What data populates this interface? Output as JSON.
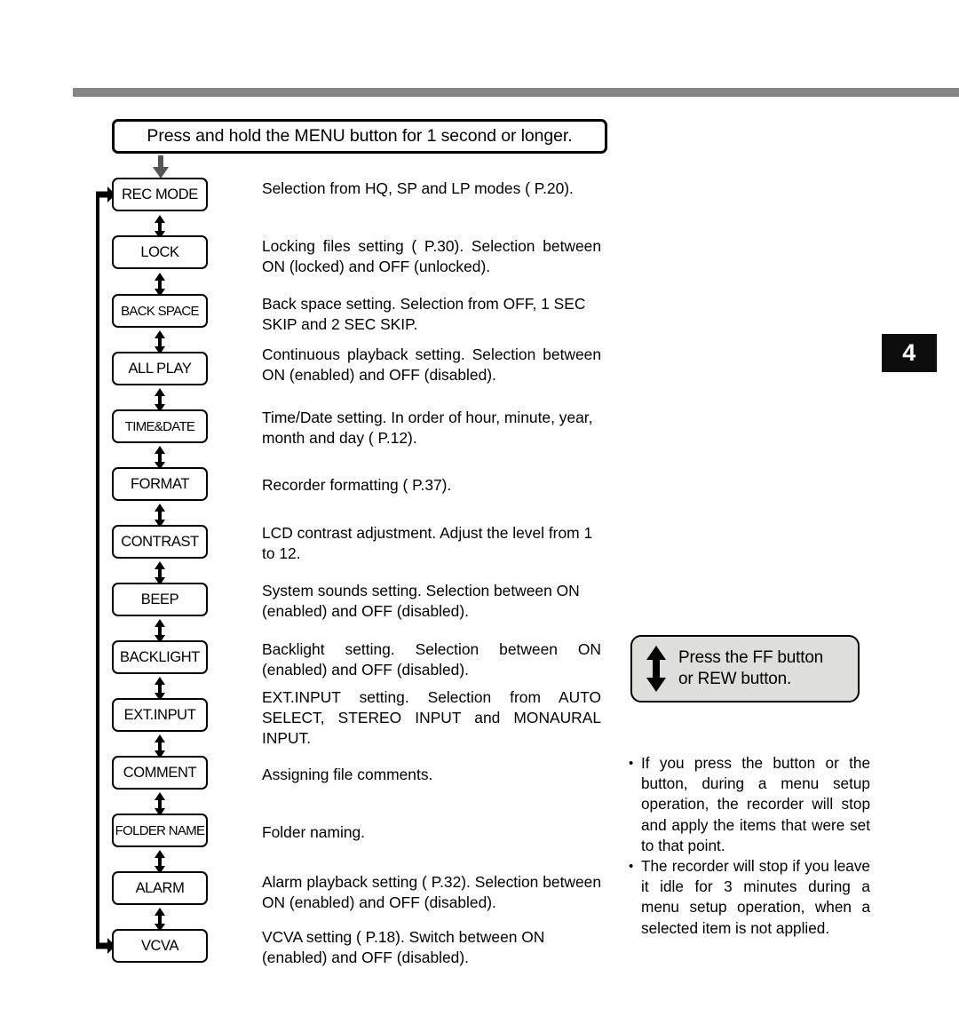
{
  "page": {
    "number": "4"
  },
  "header": {
    "instruction": "Press and hold the MENU  button for 1 second or longer."
  },
  "menu_items": [
    {
      "label": "REC MODE",
      "description": "Selection from  HQ, SP and LP modes (    P.20)."
    },
    {
      "label": "LOCK",
      "description": "Locking files setting (    P.30). Selection between ON (locked) and OFF (unlocked)."
    },
    {
      "label": "BACK SPACE",
      "description": "Back space setting. Selection from OFF, 1 SEC SKIP and 2 SEC SKIP."
    },
    {
      "label": "ALL PLAY",
      "description": "Continuous playback setting. Selection between ON (enabled) and OFF (disabled)."
    },
    {
      "label": "TIME&DATE",
      "description": "Time/Date setting. In order of hour, minute, year, month and day (    P.12)."
    },
    {
      "label": "FORMAT",
      "description": "Recorder formatting (    P.37)."
    },
    {
      "label": "CONTRAST",
      "description": "LCD contrast adjustment. Adjust the level from 1 to 12."
    },
    {
      "label": "BEEP",
      "description": "System sounds setting. Selection between ON (enabled) and OFF (disabled)."
    },
    {
      "label": "BACKLIGHT",
      "description": "Backlight setting. Selection between ON (enabled) and OFF (disabled)."
    },
    {
      "label": "EXT.INPUT",
      "description": "EXT.INPUT setting. Selection from AUTO SELECT, STEREO INPUT and MONAURAL INPUT."
    },
    {
      "label": "COMMENT",
      "description": "Assigning file comments."
    },
    {
      "label": "FOLDER NAME",
      "description": "Folder naming."
    },
    {
      "label": "ALARM",
      "description": "Alarm playback setting (    P.32). Selection between ON (enabled) and OFF (disabled)."
    },
    {
      "label": "VCVA",
      "description": "VCVA setting (    P.18).  Switch between ON (enabled) and OFF (disabled)."
    }
  ],
  "callout": {
    "text": "Press the FF button\nor REW button."
  },
  "notes": [
    {
      "bullet": "•",
      "text": "If you press the           button or the           button, during a menu setup operation, the recorder will stop and apply the items that were set to that point."
    },
    {
      "bullet": "•",
      "text": "The recorder will stop if you leave it idle for 3 minutes during a menu setup operation, when a selected item is not applied."
    }
  ],
  "colors": {
    "rule": "#868686",
    "callout_bg": "#dededd",
    "page_tab_bg": "#0d0d0d",
    "arrow_gray": "#555555"
  }
}
